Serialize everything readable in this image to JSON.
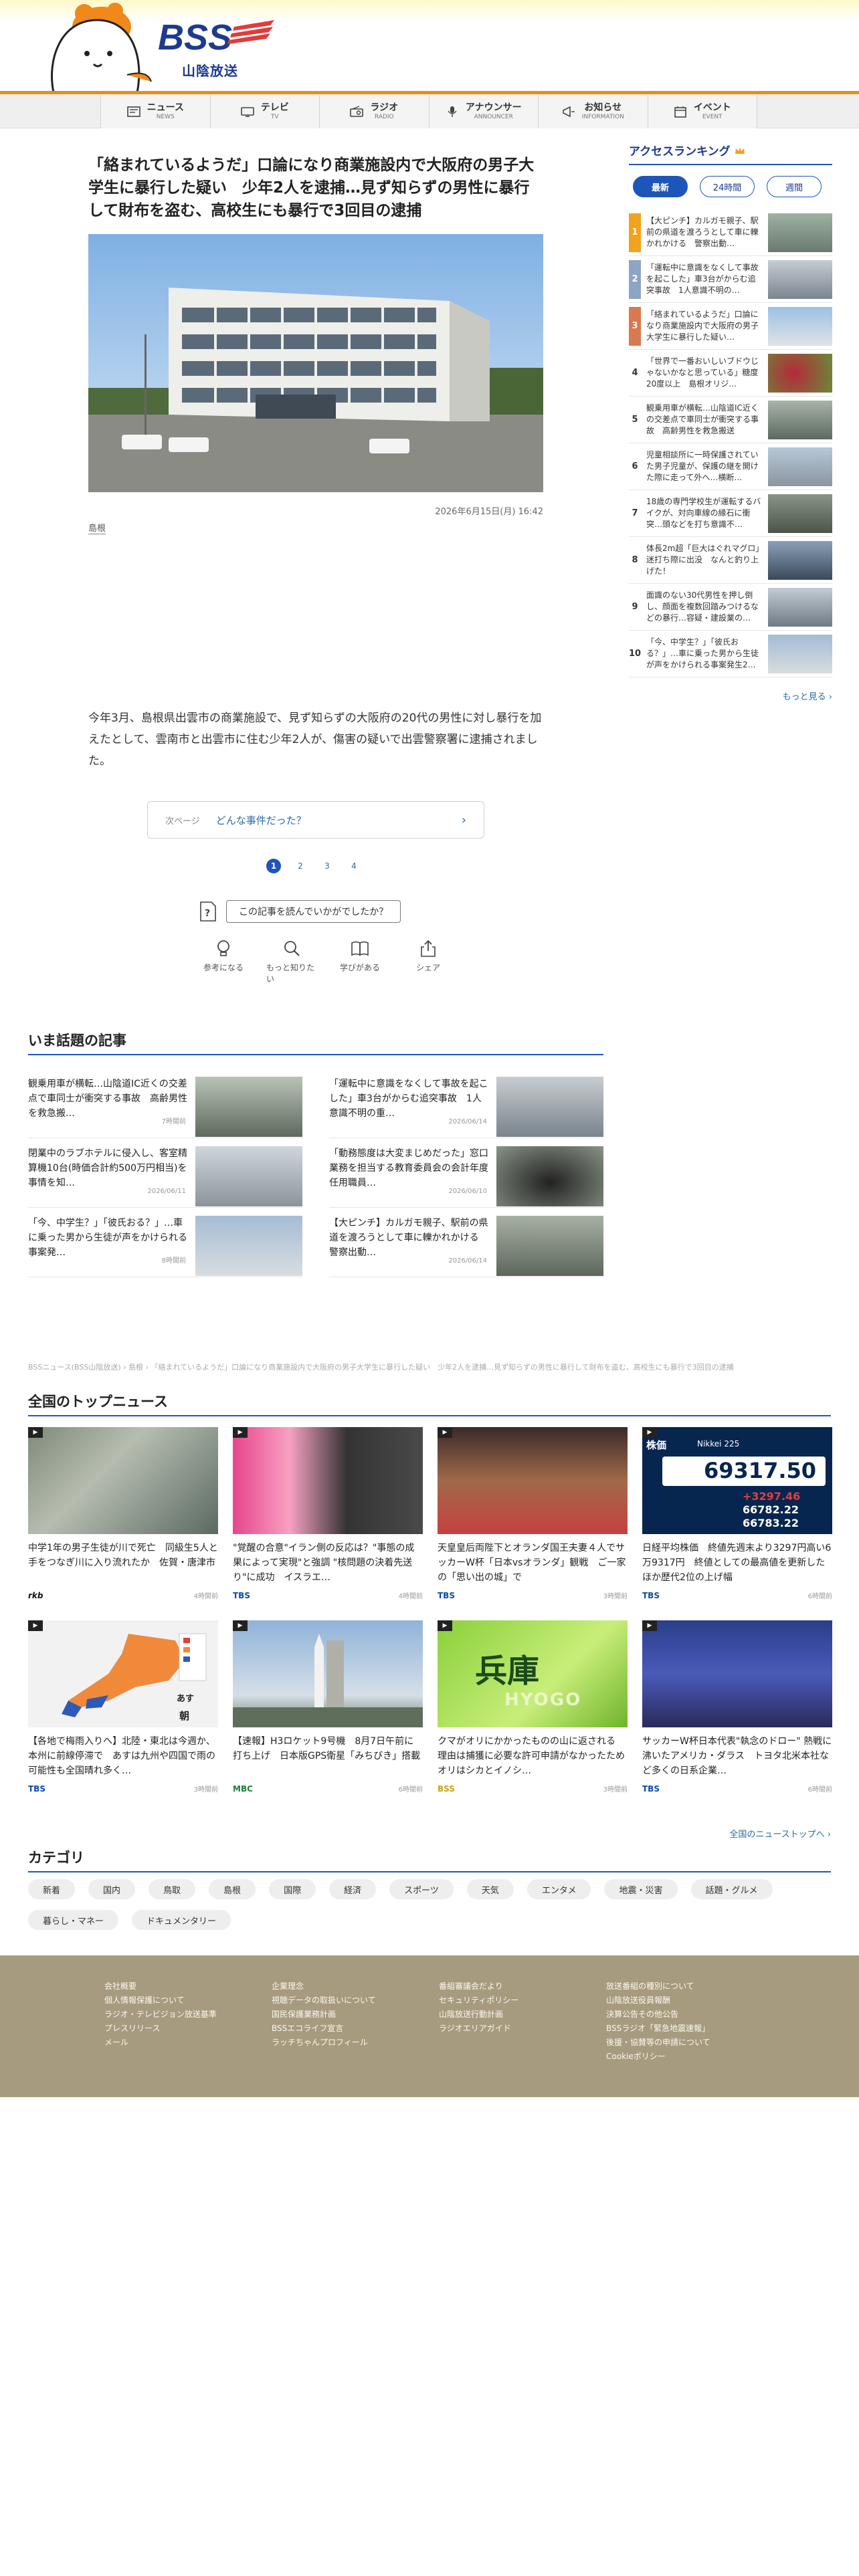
{
  "brand": {
    "logo_text": "BSS",
    "sub": "山陰放送",
    "accent": "#f08a17",
    "navy": "#1d3a8f"
  },
  "nav": [
    {
      "label": "ニュース",
      "en": "NEWS",
      "icon": "news-icon"
    },
    {
      "label": "テレビ",
      "en": "TV",
      "icon": "tv-icon"
    },
    {
      "label": "ラジオ",
      "en": "RADIO",
      "icon": "radio-icon"
    },
    {
      "label": "アナウンサー",
      "en": "ANNOUNCER",
      "icon": "microphone-icon"
    },
    {
      "label": "お知らせ",
      "en": "INFORMATION",
      "icon": "megaphone-icon"
    },
    {
      "label": "イベント",
      "en": "EVENT",
      "icon": "calendar-icon"
    }
  ],
  "article": {
    "title": "「絡まれているようだ」口論になり商業施設内で大阪府の男子大学生に暴行した疑い　少年2人を逮捕…見ず知らずの男性に暴行して財布を盗む、高校生にも暴行で3回目の逮捕",
    "date": "2026年6月15日(月) 16:42",
    "tag": "島根",
    "body": "今年3月、島根県出雲市の商業施設で、見ず知らずの大阪府の20代の男性に対し暴行を加えたとして、雲南市と出雲市に住む少年2人が、傷害の疑いで出雲警察署に逮捕されました。",
    "next_label": "次ページ",
    "next_title": "どんな事件だった？",
    "pages": [
      "1",
      "2",
      "3",
      "4"
    ],
    "reaction_question": "この記事を読んでいかがでしたか？",
    "reactions": [
      {
        "label": "参考になる",
        "icon": "lightbulb-icon"
      },
      {
        "label": "もっと知りたい",
        "icon": "search-icon"
      },
      {
        "label": "学びがある",
        "icon": "book-icon"
      },
      {
        "label": "シェア",
        "icon": "share-icon"
      }
    ]
  },
  "ranking": {
    "title": "アクセスランキング",
    "tabs": [
      "最新",
      "24時間",
      "週間"
    ],
    "more": "もっと見る ›",
    "items": [
      {
        "num": "1",
        "text": "【大ピンチ】カルガモ親子、駅前の県道を渡ろうとして車に轢かれかける　警察出動…"
      },
      {
        "num": "2",
        "text": "「運転中に意識をなくして事故を起こした」車3台がからむ追突事故　1人意識不明の…"
      },
      {
        "num": "3",
        "text": "「絡まれているようだ」口論になり商業施設内で大阪府の男子大学生に暴行した疑い…"
      },
      {
        "num": "4",
        "text": "「世界で一番おいしいブドウじゃないかなと思っている」糖度20度以上　島根オリジ…"
      },
      {
        "num": "5",
        "text": "観乗用車が横転…山陰道IC近くの交差点で車同士が衝突する事故　高齢男性を救急搬送"
      },
      {
        "num": "6",
        "text": "児童相談所に一時保護されていた男子児童が、保護の継を開けた際に走って外へ…横断…"
      },
      {
        "num": "7",
        "text": "18歳の専門学校生が運転するバイクが、対向車線の縁石に衝突…頭などを打ち意識不…"
      },
      {
        "num": "8",
        "text": "体長2m超「巨大はぐれマグロ」迷打ち際に出没　なんと釣り上げた！"
      },
      {
        "num": "9",
        "text": "面識のない30代男性を押し倒し、顔面を複数回踏みつけるなどの暴行…容疑・建設業の…"
      },
      {
        "num": "10",
        "text": "「今、中学生？」「彼氏おる？」…車に乗った男から生徒が声をかけられる事案発生2…"
      }
    ]
  },
  "trending": {
    "title": "いま話題の記事",
    "items": [
      {
        "text": "観乗用車が横転…山陰道IC近くの交差点で車同士が衝突する事故　高齢男性を救急搬…",
        "date": "7時間前"
      },
      {
        "text": "「運転中に意識をなくして事故を起こした」車3台がからむ追突事故　1人意識不明の重…",
        "date": "2026/06/14"
      },
      {
        "text": "閉業中のラブホテルに侵入し、客室精算機10台(時価合計約500万円相当)を事情を知…",
        "date": "2026/06/11"
      },
      {
        "text": "「動務態度は大変まじめだった」窓口業務を担当する教育委員会の会計年度任用職員…",
        "date": "2026/06/10"
      },
      {
        "text": "「今、中学生？」「彼氏おる？」…車に乗った男から生徒が声をかけられる事案発…",
        "date": "8時間前"
      },
      {
        "text": "【大ピンチ】カルガモ親子、駅前の県道を渡ろうとして車に轢かれかける　警察出動…",
        "date": "2026/06/14"
      }
    ]
  },
  "breadcrumb": "BSSニュース(BSS山陰放送) › 島根 › 「絡まれているようだ」口論になり商業施設内で大阪府の男子大学生に暴行した疑い　少年2人を逮捕…見ず知らずの男性に暴行して財布を盗む、高校生にも暴行で3回目の逮捕",
  "top_news": {
    "title": "全国のトップニュース",
    "all_link": "全国のニューストップへ ›",
    "items": [
      {
        "title": "中学1年の男子生徒が川で死亡　同級生5人と手をつなぎ川に入り流れたか　佐賀・唐津市",
        "source": "rkb",
        "source_color": "#111111",
        "time": "4時間前"
      },
      {
        "title": "\"覚醒の合意\"イラン側の反応は？\"事態の成果によって実現\"と強調 \"核問題の決着先送り\"に成功　イスラエ…",
        "source": "TBS",
        "source_color": "#0b4aa6",
        "time": "4時間前"
      },
      {
        "title": "天皇皇后両陛下とオランダ国王夫妻４人でサッカーW杯「日本vsオランダ」観戦　ご一家の「思い出の城」で",
        "source": "TBS",
        "source_color": "#0b4aa6",
        "time": "3時間前"
      },
      {
        "title": "日経平均株価　終値先週末より3297円高い6万9317円　終値としての最高値を更新したほか歴代2位の上げ幅",
        "source": "TBS",
        "source_color": "#0b4aa6",
        "time": "6時間前"
      },
      {
        "title": "【各地で梅雨入りへ】北陸・東北は今週か、本州に前線停滞で　あすは九州や四国で雨の可能性も全国晴れ多く…",
        "source": "TBS",
        "source_color": "#0b4aa6",
        "time": "3時間前"
      },
      {
        "title": "【速報】H3ロケット9号機　8月7日午前に打ち上げ　日本版GPS衛星「みちびき」搭載",
        "source": "MBC",
        "source_color": "#1a7a3a",
        "time": "6時間前"
      },
      {
        "title": "クマがオリにかかったものの山に返される　理由は捕獲に必要な許可申請がなかったため　オリはシカとイノシ…",
        "source": "BSS",
        "source_color": "#c8a21a",
        "time": "3時間前"
      },
      {
        "title": "サッカーW杯日本代表\"執念のドロー\" 熱戦に沸いたアメリカ・ダラス　トヨタ北米本社など多くの日系企業…",
        "source": "TBS",
        "source_color": "#0b4aa6",
        "time": "6時間前"
      }
    ],
    "thumb_texts": {
      "stock_label": "株価",
      "stock_index": "Nikkei 225",
      "stock_value": "69317.50",
      "stock_change": "+3297.46",
      "stock_sub1": "66782.22",
      "stock_sub2": "66783.22",
      "hyogo": "兵庫",
      "hyogo_en": "HYOGO",
      "weather_tomorrow": "あす",
      "weather_morning": "朝"
    }
  },
  "categories": {
    "title": "カテゴリ",
    "items": [
      "新着",
      "国内",
      "鳥取",
      "島根",
      "国際",
      "経済",
      "スポーツ",
      "天気",
      "エンタメ",
      "地震・災害",
      "話題・グルメ",
      "暮らし・マネー",
      "ドキュメンタリー"
    ]
  },
  "footer": {
    "cols": [
      [
        "会社概要",
        "個人情報保護について",
        "ラジオ・テレビジョン放送基準",
        "プレスリリース",
        "メール"
      ],
      [
        "企業理念",
        "視聴データの取扱いについて",
        "国民保護業務計画",
        "BSSエコライフ宣言",
        "ラッチちゃんプロフィール"
      ],
      [
        "番組審議会だより",
        "セキュリティポリシー",
        "山陰放送行動計画",
        "ラジオエリアガイド"
      ],
      [
        "放送番組の種別について",
        "山陰放送役員報酬",
        "決算公告その他公告",
        "BSSラジオ「緊急地震速報」",
        "後援・協賛等の申請について",
        "Cookieポリシー"
      ]
    ]
  }
}
